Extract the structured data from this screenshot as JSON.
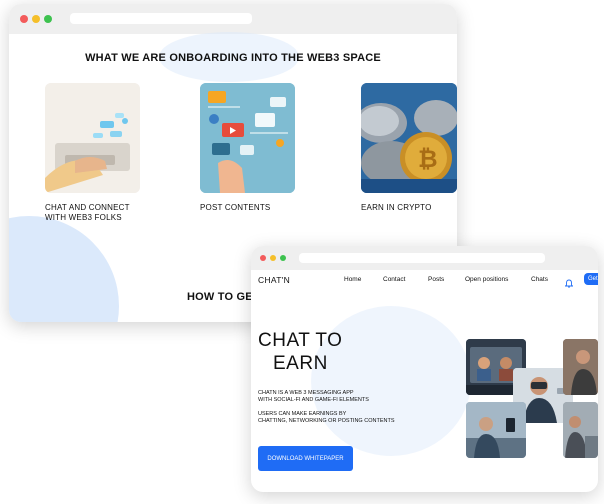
{
  "colors": {
    "accent": "#1f6cf5",
    "dot_red": "#f35b5b",
    "dot_yellow": "#f5bf2a",
    "dot_green": "#3dc24f",
    "blob": "#dbe9fb"
  },
  "onboarding": {
    "heading": "WHAT WE ARE ONBOARDING INTO THE WEB3 SPACE",
    "cards": [
      {
        "caption_line1": "CHAT AND CONNECT",
        "caption_line2": "WITH WEB3 FOLKS",
        "icon": "chat-laptop-image"
      },
      {
        "caption_line1": "POST CONTENTS",
        "caption_line2": "",
        "icon": "post-contents-image"
      },
      {
        "caption_line1": "EARN IN CRYPTO",
        "caption_line2": "",
        "icon": "crypto-coins-image"
      }
    ],
    "footer_heading": "HOW TO GET"
  },
  "app": {
    "logo": "CHAT'N",
    "nav": [
      "Home",
      "Contact",
      "Posts",
      "Open positions",
      "Chats"
    ],
    "nav_button": "Get",
    "hero_line1": "CHAT TO",
    "hero_line2": "EARN",
    "desc1_line1": "CHATN IS A WEB 3 MESSAGING  APP",
    "desc1_line2": "WITH SOCIAL-FI AND GAME-FI ELEMENTS",
    "desc2_line1": "USERS CAN MAKE  EARNINGS BY",
    "desc2_line2": "CHATTING, NETWORKING OR POSTING CONTENTS",
    "cta": "DOWNLOAD WHITEPAPER"
  }
}
